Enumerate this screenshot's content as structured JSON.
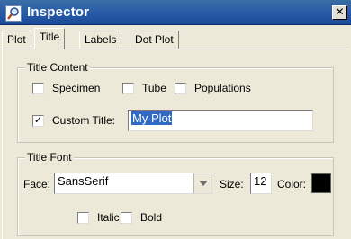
{
  "window": {
    "title": "Inspector",
    "close_glyph": "✕"
  },
  "tabs": [
    {
      "label": "Plot",
      "active": false
    },
    {
      "label": "Title",
      "active": true
    },
    {
      "label": "Labels",
      "active": false
    },
    {
      "label": "Dot Plot",
      "active": false
    }
  ],
  "title_content": {
    "legend": "Title Content",
    "specimen": {
      "label": "Specimen",
      "checked": false
    },
    "tube": {
      "label": "Tube",
      "checked": false
    },
    "populations": {
      "label": "Populations",
      "checked": false
    },
    "custom_title": {
      "label": "Custom Title:",
      "checked": true,
      "value": "My Plot"
    }
  },
  "title_font": {
    "legend": "Title Font",
    "face_label": "Face:",
    "face_value": "SansSerif",
    "size_label": "Size:",
    "size_value": "12",
    "color_label": "Color:",
    "color_value": "#000000",
    "italic": {
      "label": "Italic",
      "checked": false
    },
    "bold": {
      "label": "Bold",
      "checked": false
    }
  },
  "icons": {
    "app": "magnifier-icon"
  }
}
